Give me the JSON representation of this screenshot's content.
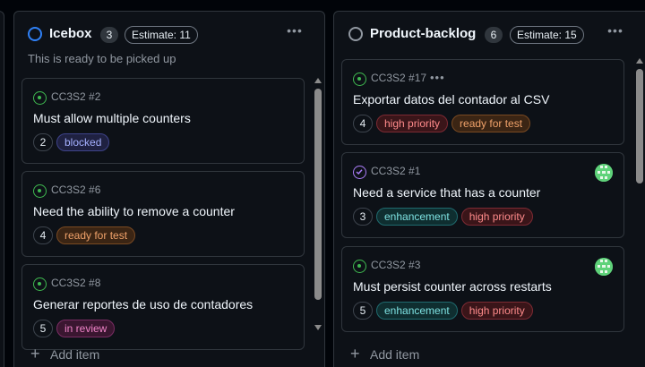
{
  "columns": [
    {
      "title": "Icebox",
      "count": "3",
      "estimate": "Estimate: 11",
      "description": "This is ready to be picked up",
      "status_color": "#2f81f7",
      "cards": [
        {
          "ref": "CC3S2 #2",
          "title": "Must allow multiple counters",
          "estimate": "2",
          "labels": [
            "blocked"
          ]
        },
        {
          "ref": "CC3S2 #6",
          "title": "Need the ability to remove a counter",
          "estimate": "4",
          "labels": [
            "ready for test"
          ]
        },
        {
          "ref": "CC3S2 #8",
          "title": "Generar reportes de uso de contadores",
          "estimate": "5",
          "labels": [
            "in review"
          ]
        }
      ],
      "add_item": "Add item"
    },
    {
      "title": "Product-backlog",
      "count": "6",
      "estimate": "Estimate: 15",
      "status_color": "#9198a1",
      "cards": [
        {
          "ref": "CC3S2 #17",
          "title": "Exportar datos del contador al CSV",
          "estimate": "4",
          "labels": [
            "high priority",
            "ready for test"
          ]
        },
        {
          "ref": "CC3S2 #1",
          "title": "Need a service that has a counter",
          "estimate": "3",
          "labels": [
            "enhancement",
            "high priority"
          ],
          "icon": "issue-closed-icon"
        },
        {
          "ref": "CC3S2 #3",
          "title": "Must persist counter across restarts",
          "estimate": "5",
          "labels": [
            "enhancement",
            "high priority"
          ]
        }
      ],
      "add_item": "Add item"
    }
  ],
  "colors": {
    "background": "#010409",
    "column": "#0d1117",
    "border": "#30363d",
    "open_issue": "#3fb950",
    "closed_issue": "#ab7df8"
  },
  "icons": [
    "circle-status-icon",
    "kebab-menu-icon",
    "issue-open-icon",
    "issue-closed-icon",
    "avatar-icon",
    "plus-icon"
  ]
}
